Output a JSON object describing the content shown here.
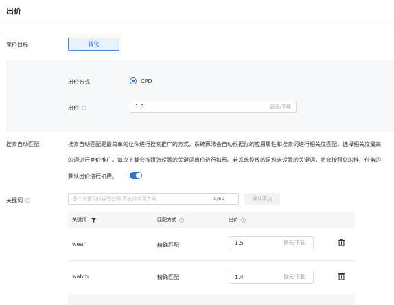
{
  "page": {
    "title": "出价"
  },
  "goal": {
    "label": "竞价目标",
    "button": "转化"
  },
  "bid_method": {
    "label": "出价方式",
    "option": "CPD"
  },
  "bid": {
    "label": "出价",
    "value": "1.3",
    "unit": "欧元/下载"
  },
  "auto_match": {
    "label": "搜索自动匹配",
    "line1": "搜索自动匹配是最简单的让你进行搜索推广的方式，系统算法会自动根据你的应用属性和搜索词进行相关度匹配，选择相关度最高",
    "line2": "的词进行竞价推广。每次下载会按照您设置的关键词出价进行扣费。若系统投放的是您未设置的关键词，将会按照您的推广任务的",
    "line3": "默认出价进行扣费。",
    "enabled": true
  },
  "keywords": {
    "label": "关键词",
    "placeholder": "多个关键词以逗号分隔,不支持大写字母",
    "counter": "0/60",
    "confirm": "确认添加",
    "columns": {
      "keyword": "关键词",
      "match": "匹配方式",
      "bid": "出价"
    },
    "rows": [
      {
        "keyword": "wear",
        "match": "精确匹配",
        "bid": "1.5",
        "unit": "欧元/下载"
      },
      {
        "keyword": "watch",
        "match": "精确匹配",
        "bid": "1.4",
        "unit": "欧元/下载"
      }
    ]
  },
  "colors": {
    "accent": "#2f6fd0",
    "panel": "#f7f8fa",
    "border": "#d9d9d9"
  },
  "icons": [
    "question-icon",
    "filter-icon",
    "trash-icon"
  ]
}
